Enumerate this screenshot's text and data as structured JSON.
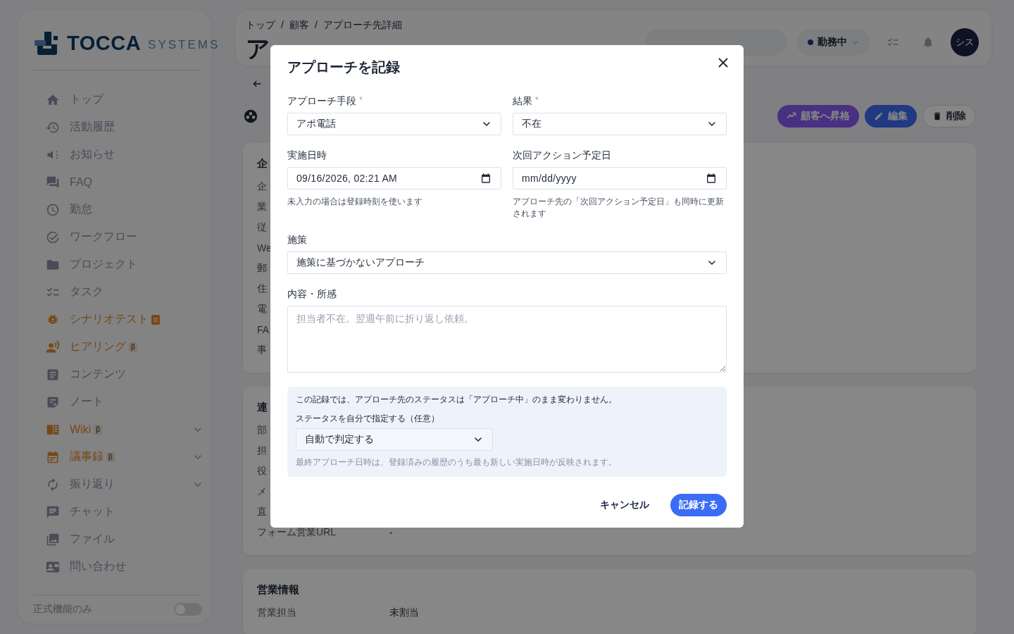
{
  "sidebar": {
    "logo": {
      "brand": "TOCCA",
      "suffix": "SYSTEMS"
    },
    "items": [
      {
        "label": "トップ",
        "kind": "normal",
        "expandable": false
      },
      {
        "label": "活動履歴",
        "kind": "normal",
        "expandable": false
      },
      {
        "label": "お知らせ",
        "kind": "normal",
        "expandable": false
      },
      {
        "label": "FAQ",
        "kind": "normal",
        "expandable": false
      },
      {
        "label": "勤怠",
        "kind": "normal",
        "expandable": false
      },
      {
        "label": "ワークフロー",
        "kind": "normal",
        "expandable": false
      },
      {
        "label": "プロジェクト",
        "kind": "normal",
        "expandable": false
      },
      {
        "label": "タスク",
        "kind": "normal",
        "expandable": false
      },
      {
        "label": "シナリオテスト",
        "kind": "alpha",
        "badge": "α",
        "expandable": false
      },
      {
        "label": "ヒアリング",
        "kind": "beta",
        "badge": "β",
        "expandable": false
      },
      {
        "label": "コンテンツ",
        "kind": "normal",
        "expandable": false
      },
      {
        "label": "ノート",
        "kind": "normal",
        "expandable": false
      },
      {
        "label": "Wiki",
        "kind": "beta",
        "badge": "β",
        "expandable": true
      },
      {
        "label": "議事録",
        "kind": "beta",
        "badge": "β",
        "expandable": true
      },
      {
        "label": "振り返り",
        "kind": "normal",
        "expandable": true
      },
      {
        "label": "チャット",
        "kind": "normal",
        "expandable": false
      },
      {
        "label": "ファイル",
        "kind": "normal",
        "expandable": false
      },
      {
        "label": "問い合わせ",
        "kind": "normal",
        "expandable": false
      }
    ],
    "footer": {
      "label": "正式機能のみ",
      "on": false
    }
  },
  "header": {
    "breadcrumb": [
      "トップ",
      "顧客",
      "アプローチ先詳細"
    ],
    "separator": "/",
    "title": "ア",
    "status": "勤務中",
    "avatar": "シス"
  },
  "page": {
    "actions": [
      {
        "label": "顧客へ昇格",
        "kind": "promote"
      },
      {
        "label": "編集",
        "kind": "edit"
      },
      {
        "label": "削除",
        "kind": "delete"
      }
    ],
    "sections": [
      {
        "title": "企",
        "rows": [
          {
            "label": "企"
          },
          {
            "label": "業"
          },
          {
            "label": "従"
          },
          {
            "label": "We"
          },
          {
            "label": "郵"
          },
          {
            "label": "住"
          },
          {
            "label": "電"
          },
          {
            "label": "FA"
          },
          {
            "label": "事"
          }
        ]
      },
      {
        "title": "連",
        "rows": [
          {
            "label": "部"
          },
          {
            "label": "担"
          },
          {
            "label": "役"
          },
          {
            "label": "メ"
          },
          {
            "label": "直"
          },
          {
            "label": "フォーム営業URL",
            "value": "-"
          }
        ]
      },
      {
        "title": "営業情報",
        "rows": [
          {
            "label": "営業担当",
            "value": "未割当"
          }
        ]
      }
    ]
  },
  "modal": {
    "title": "アプローチを記録",
    "fields": [
      {
        "kind": "select",
        "label": "アプローチ手段",
        "required_mark": "*",
        "value": "アポ電話"
      },
      {
        "kind": "select",
        "label": "結果",
        "required_mark": "*",
        "value": "不在"
      },
      {
        "kind": "date",
        "label": "実施日時",
        "value": "09/16/2026, 02:21 AM",
        "help": "未入力の場合は登録時刻を使います"
      },
      {
        "kind": "date",
        "label": "次回アクション予定日",
        "placeholder": "mm/dd/yyyy",
        "help": "アプローチ先の「次回アクション予定日」も同時に更新されます"
      },
      {
        "kind": "select",
        "label": "施策",
        "value": "施策に基づかないアプローチ",
        "wide": true
      },
      {
        "kind": "textarea",
        "label": "内容・所感",
        "placeholder": "担当者不在。翌週午前に折り返し依頼。",
        "wide": true
      }
    ],
    "info": {
      "note": "この記録では、アプローチ先のステータスは「アプローチ中」のまま変わりません。",
      "status_label": "ステータスを自分で指定する（任意）",
      "status_value": "自動で判定する",
      "footnote": "最終アプローチ日時は、登録済みの履歴のうち最も新しい実施日時が反映されます。"
    },
    "cancel": "キャンセル",
    "submit": "記録する"
  }
}
